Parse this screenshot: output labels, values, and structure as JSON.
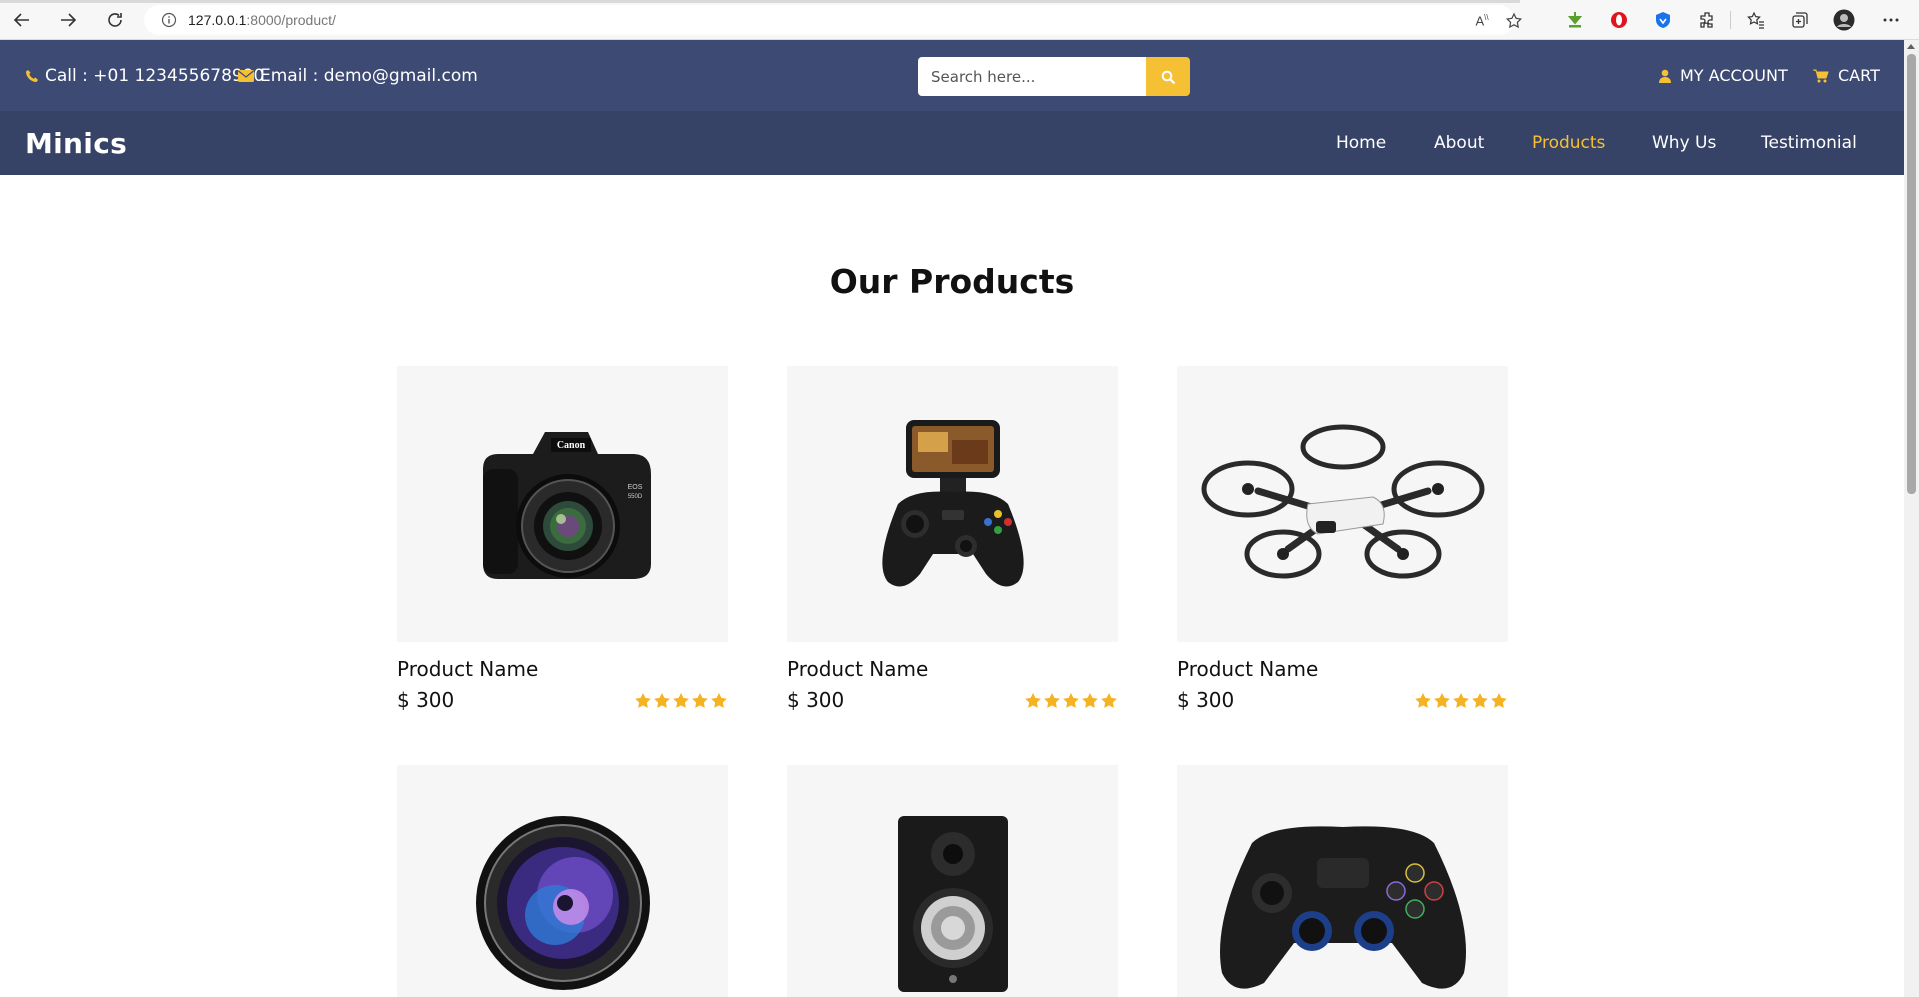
{
  "browser": {
    "url_host": "127.0.0.1",
    "url_port_path": ":8000/product/"
  },
  "topbar": {
    "call_text": "Call : +01 123455678990",
    "email_text": "Email : demo@gmail.com",
    "search_placeholder": "Search here...",
    "account_label": "MY ACCOUNT",
    "cart_label": "CART"
  },
  "nav": {
    "brand": "Minics",
    "links": [
      {
        "label": "Home",
        "active": false
      },
      {
        "label": "About",
        "active": false
      },
      {
        "label": "Products",
        "active": true
      },
      {
        "label": "Why Us",
        "active": false
      },
      {
        "label": "Testimonial",
        "active": false
      }
    ]
  },
  "section": {
    "title": "Our Products"
  },
  "products": [
    {
      "name": "Product Name",
      "price": "$ 300",
      "rating": 5,
      "image": "dslr-camera"
    },
    {
      "name": "Product Name",
      "price": "$ 300",
      "rating": 5,
      "image": "phone-gamepad"
    },
    {
      "name": "Product Name",
      "price": "$ 300",
      "rating": 5,
      "image": "quadcopter-drone"
    },
    {
      "name": "",
      "price": "",
      "rating": 0,
      "image": "camera-lens"
    },
    {
      "name": "",
      "price": "",
      "rating": 0,
      "image": "studio-speaker"
    },
    {
      "name": "",
      "price": "",
      "rating": 0,
      "image": "game-controller"
    }
  ],
  "colors": {
    "topbar": "#3d4a73",
    "nav": "#364366",
    "accent": "#f5c033",
    "card_bg": "#f6f6f6"
  }
}
